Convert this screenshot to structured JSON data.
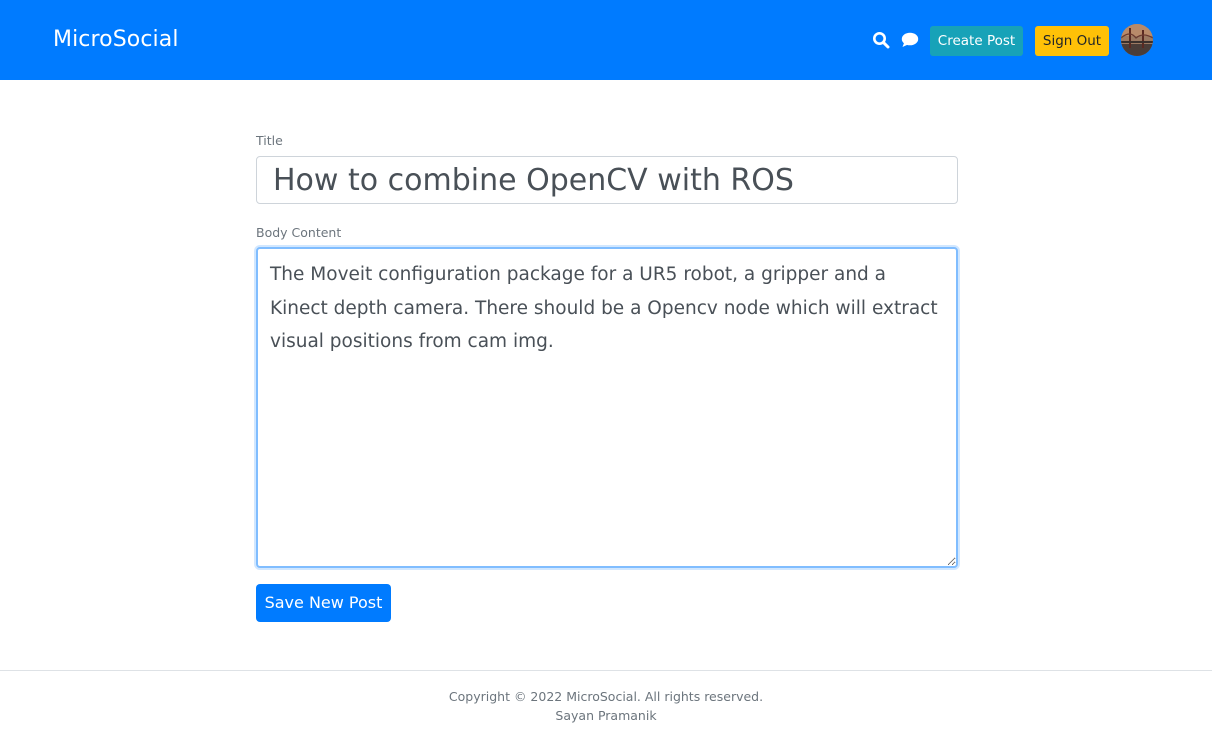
{
  "navbar": {
    "brand": "MicroSocial",
    "search_icon": "search-icon",
    "chat_icon": "chat-icon",
    "create_post_label": "Create Post",
    "sign_out_label": "Sign Out",
    "colors": {
      "background": "#007bff",
      "create_post": "#17a2b8",
      "sign_out": "#ffc107"
    }
  },
  "form": {
    "title_label": "Title",
    "title_value": "How to combine OpenCV with ROS",
    "body_label": "Body Content",
    "body_value": "The Moveit configuration package for a UR5 robot, a gripper and a Kinect depth camera. There should be a Opencv node which will extract visual positions from cam img.",
    "save_label": "Save New Post"
  },
  "footer": {
    "copyright": "Copyright © 2022 MicroSocial. All rights reserved.",
    "author": "Sayan Pramanik"
  }
}
